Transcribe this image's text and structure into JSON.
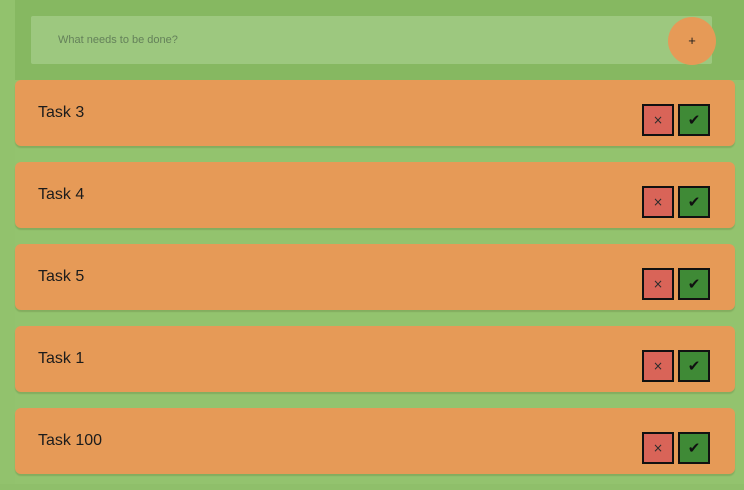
{
  "todo_input": {
    "placeholder": "What needs to be done?",
    "add_label": "+"
  },
  "tasks": [
    {
      "title": "Task 3",
      "delete_label": "×",
      "complete_label": "✔"
    },
    {
      "title": "Task 4",
      "delete_label": "×",
      "complete_label": "✔"
    },
    {
      "title": "Task 5",
      "delete_label": "×",
      "complete_label": "✔"
    },
    {
      "title": "Task 1",
      "delete_label": "×",
      "complete_label": "✔"
    },
    {
      "title": "Task 100",
      "delete_label": "×",
      "complete_label": "✔"
    }
  ],
  "colors": {
    "background": "#93c36e",
    "header_background": "#86b861",
    "input_background": "#9dc87f",
    "task_background": "#e69a57",
    "add_button": "#e69a57",
    "delete_button": "#d96458",
    "complete_button": "#3f8a36",
    "button_border": "#111111"
  },
  "icons": {
    "add": "plus-icon",
    "delete": "close-icon",
    "complete": "check-icon"
  }
}
